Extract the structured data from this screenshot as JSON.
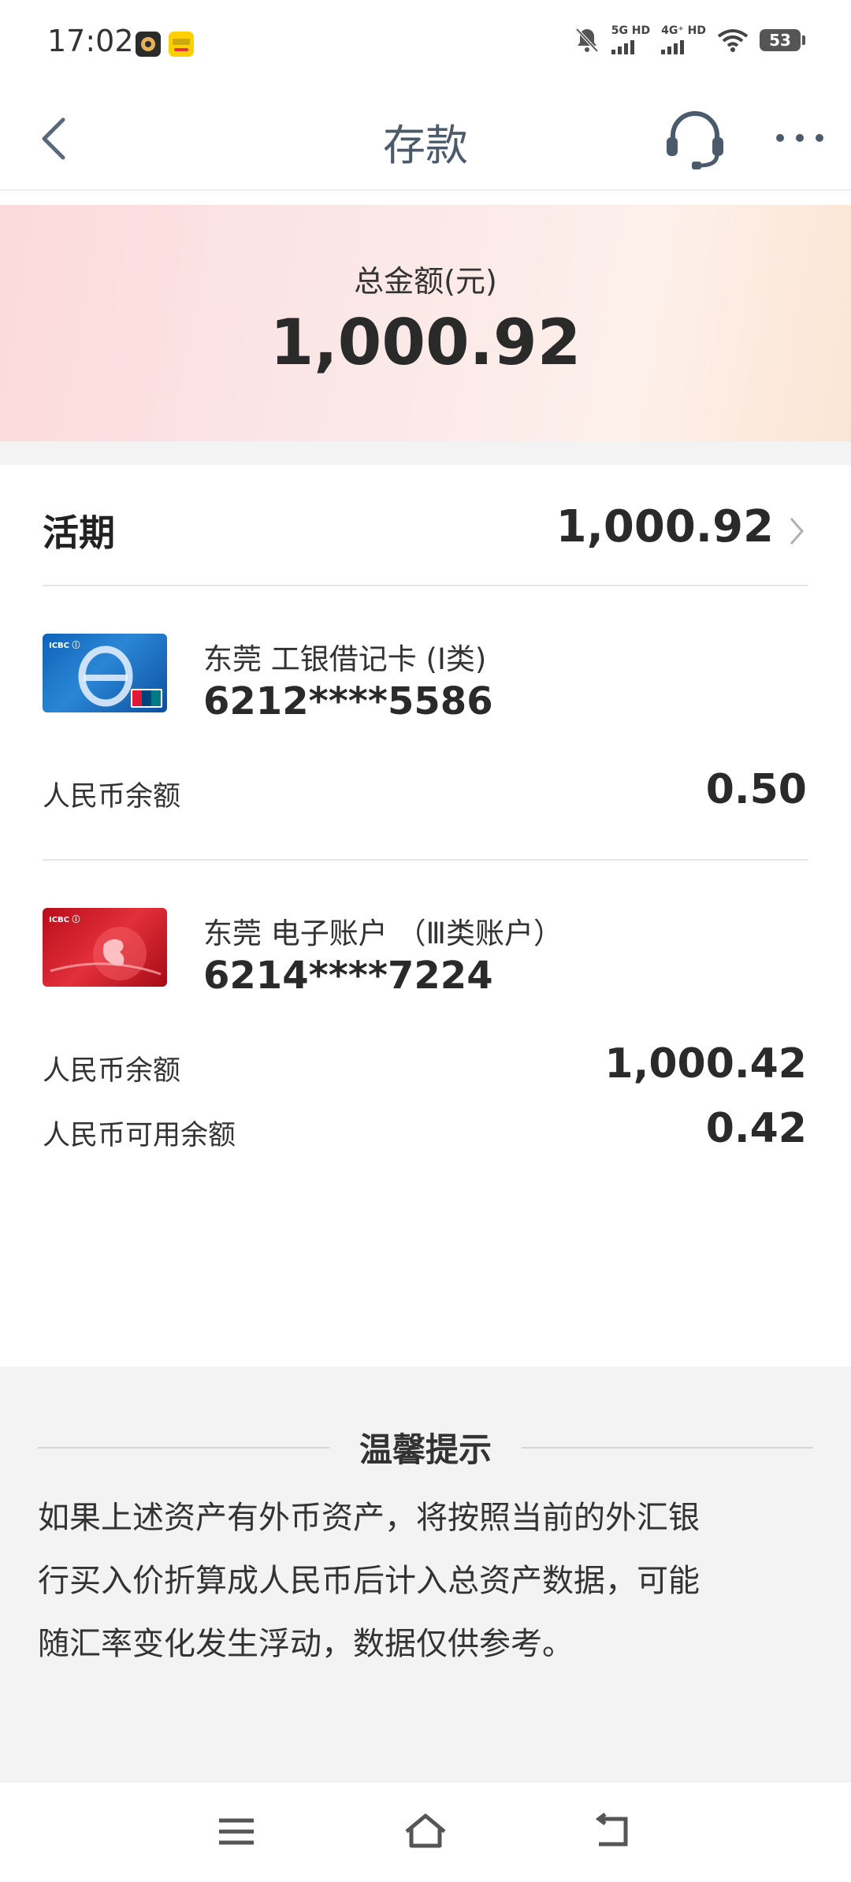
{
  "status_bar": {
    "time": "17:02",
    "net1": "5G HD",
    "net2": "4G⁺ HD",
    "battery": "53",
    "icons": [
      "app-icon",
      "meituan-icon",
      "mute-bell-icon",
      "signal-icon",
      "wifi-icon",
      "battery-icon"
    ]
  },
  "nav": {
    "title": "存款",
    "icons": [
      "back-icon",
      "customer-service-icon",
      "more-icon"
    ]
  },
  "hero": {
    "label": "总金额(元)",
    "amount": "1,000.92"
  },
  "section": {
    "title": "活期",
    "total": "1,000.92"
  },
  "accounts": [
    {
      "name": "东莞 工银借记卡 (I类)",
      "number": "6212****5586",
      "rows": [
        {
          "label": "人民币余额",
          "value": "0.50"
        }
      ]
    },
    {
      "name": "东莞 电子账户 （Ⅲ类账户）",
      "number": "6214****7224",
      "rows": [
        {
          "label": "人民币余额",
          "value": "1,000.42"
        },
        {
          "label": "人民币可用余额",
          "value": "0.42"
        }
      ]
    }
  ],
  "tips": {
    "title": "温馨提示",
    "lines": [
      "如果上述资产有外币资产，将按照当前的外汇银",
      "行买入价折算成人民币后计入总资产数据，可能",
      "随汇率变化发生浮动，数据仅供参考。"
    ]
  },
  "colors": {
    "hero_start": "#fcdadb",
    "hero_end": "#fce5d4",
    "nav_title": "#4b5b6c",
    "tips_bg": "#f3f3f3"
  }
}
